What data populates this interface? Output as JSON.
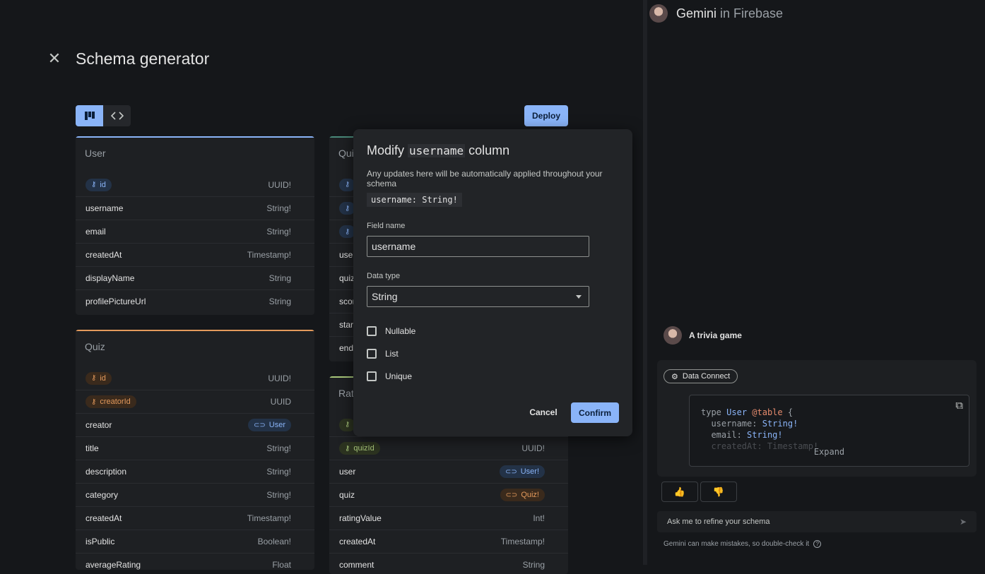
{
  "page": {
    "title": "Schema generator",
    "deploy_label": "Deploy"
  },
  "colors": {
    "accent": "#8ab4f8",
    "background": "#15171a",
    "card": "#1e2023",
    "orange_key": "#e49a5c",
    "green_key": "#a8c77a"
  },
  "cards": {
    "user": {
      "title": "User",
      "rows": [
        {
          "name": "id",
          "type": "UUID!"
        },
        {
          "name": "username",
          "type": "String!"
        },
        {
          "name": "email",
          "type": "String!"
        },
        {
          "name": "createdAt",
          "type": "Timestamp!"
        },
        {
          "name": "displayName",
          "type": "String"
        },
        {
          "name": "profilePictureUrl",
          "type": "String"
        }
      ]
    },
    "quiz": {
      "title": "Quiz",
      "rows": [
        {
          "name": "id",
          "type": "UUID!"
        },
        {
          "name": "creatorId",
          "type": "UUID"
        },
        {
          "name": "creator",
          "type": "User"
        },
        {
          "name": "title",
          "type": "String!"
        },
        {
          "name": "description",
          "type": "String!"
        },
        {
          "name": "category",
          "type": "String!"
        },
        {
          "name": "createdAt",
          "type": "Timestamp!"
        },
        {
          "name": "isPublic",
          "type": "Boolean!"
        },
        {
          "name": "averageRating",
          "type": "Float"
        }
      ]
    },
    "quizattempt": {
      "title": "Qui",
      "rows": [
        "use",
        "quiz",
        "scor",
        "star",
        "end"
      ]
    },
    "rating": {
      "title": "Rat",
      "rows": [
        {
          "name": "quizId",
          "type": "UUID!"
        },
        {
          "name": "user",
          "type": "User!"
        },
        {
          "name": "quiz",
          "type": "Quiz!"
        },
        {
          "name": "ratingValue",
          "type": "Int!"
        },
        {
          "name": "createdAt",
          "type": "Timestamp!"
        },
        {
          "name": "comment",
          "type": "String"
        }
      ]
    }
  },
  "modal": {
    "title_prefix": "Modify",
    "title_field": "username",
    "title_suffix": "column",
    "description": "Any updates here will be automatically applied throughout your schema",
    "code": "username: String!",
    "field_name_label": "Field name",
    "field_name_value": "username",
    "data_type_label": "Data type",
    "data_type_value": "String",
    "options": {
      "nullable": "Nullable",
      "list": "List",
      "unique": "Unique"
    },
    "cancel": "Cancel",
    "confirm": "Confirm"
  },
  "gemini": {
    "brand": "Gemini",
    "sub": " in Firebase",
    "user_message": "A trivia game",
    "chip": "Data Connect",
    "code": {
      "kw_type": "type",
      "type_name": "User",
      "directive": "@table",
      "brace": "{",
      "f1": "username:",
      "f1t": "String!",
      "f2": "email:",
      "f2t": "String!",
      "f3": "createdAt: Timestamp!"
    },
    "expand": "Expand",
    "prompt_placeholder": "Ask me to refine your schema",
    "disclaimer": "Gemini can make mistakes, so double-check it"
  }
}
